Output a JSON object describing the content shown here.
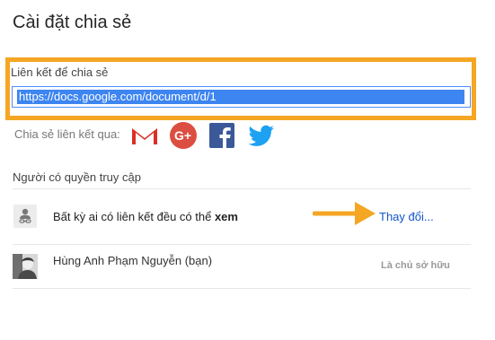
{
  "dialog": {
    "title": "Cài đặt chia sẻ"
  },
  "link_section": {
    "label": "Liên kết để chia sẻ",
    "url": "https://docs.google.com/document/d/1"
  },
  "share_via": {
    "label": "Chia sẻ liên kết qua:",
    "services": [
      "gmail-icon",
      "google-plus-icon",
      "facebook-icon",
      "twitter-icon"
    ]
  },
  "access": {
    "heading": "Người có quyền truy cập",
    "link_row": {
      "text_prefix": "Bất kỳ ai có liên kết đều có thể ",
      "text_bold": "xem",
      "change_label": "Thay đổi..."
    },
    "owner_row": {
      "name": "Hùng Anh Phạm Nguyễn (bạn)",
      "role": "Là chủ sở hữu"
    }
  },
  "colors": {
    "highlight_border": "#f5a623",
    "selection": "#3d85f0",
    "link": "#1155cc",
    "arrow": "#f5a623"
  }
}
